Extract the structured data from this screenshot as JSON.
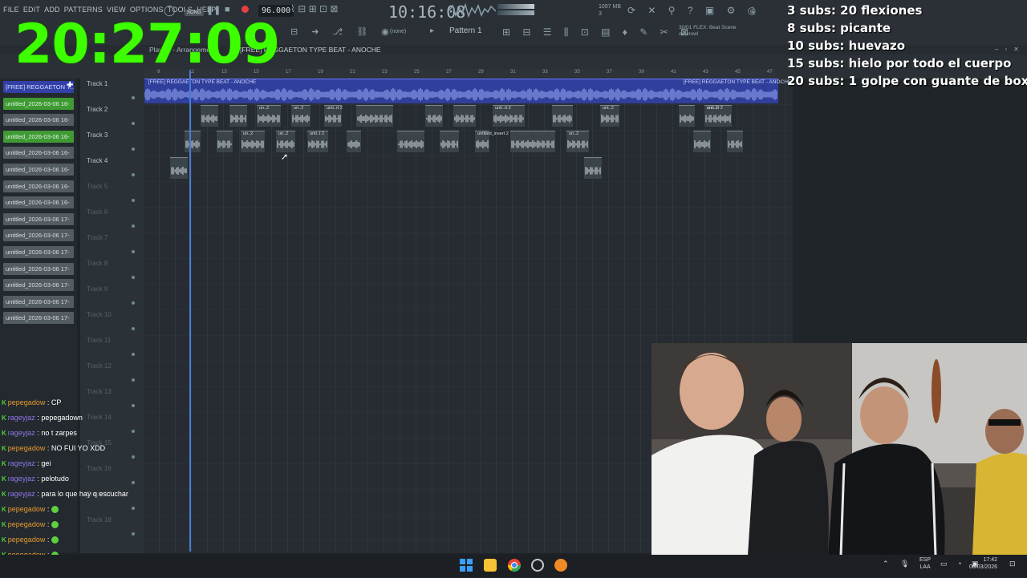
{
  "menu": [
    "FILE",
    "EDIT",
    "ADD",
    "PATTERNS",
    "VIEW",
    "OPTIONS",
    "TOOLS",
    "HELP"
  ],
  "transport": {
    "song_label": "SONG",
    "tempo": "96.000",
    "time": "10:16:08",
    "pattern": "Pattern 1",
    "snap": "(none)",
    "cpu_text": "1097 MB",
    "cpu_sub": "3"
  },
  "news": {
    "line1": "30/01  FLEX: Beat Scene",
    "line2": "out now!"
  },
  "overlay_clock": "20:27:09",
  "subs": [
    "3 subs: 20 flexiones",
    "8 subs: picante",
    "10 subs: huevazo",
    "15 subs: hielo por todo el cuerpo",
    "20 subs: 1 golpe con guante de box"
  ],
  "playlist": {
    "title_prefix": "Playlist - Arrangement",
    "title_clip": "[FREE] REGGAETON TYPE BEAT - ANOCHE",
    "beat_clip_label": "[FREE] REGGAETON TYPE BEAT - ANOCHE",
    "ruler": [
      "9",
      "11",
      "13",
      "15",
      "17",
      "19",
      "21",
      "23",
      "25",
      "27",
      "29",
      "31",
      "33",
      "35",
      "37",
      "39",
      "41",
      "43",
      "45",
      "47"
    ],
    "tracks": [
      "Track 1",
      "Track 2",
      "Track 3",
      "Track 4",
      "Track 5",
      "Track 6",
      "Track 7",
      "Track 8",
      "Track 9",
      "Track 10",
      "Track 11",
      "Track 12",
      "Track 13",
      "Track 14",
      "Track 15",
      "Track 16",
      "Track 17",
      "Track 18"
    ],
    "clip_labels_t2": [
      "un..2",
      "un..2",
      "unti..rt 2",
      "unti..rt 2",
      "unt..2",
      "unti..rt 2",
      "unt..2"
    ],
    "clip_labels_t3": [
      "un..2",
      "un..2",
      "unti..t 2",
      "untitled_insert 2",
      "un..2"
    ]
  },
  "picker": [
    {
      "label": "[FREE] REGGAETON T...",
      "style": "blue"
    },
    {
      "label": "untitled_2026-03-06 16-",
      "style": "green"
    },
    {
      "label": "untitled_2026-03-06 16-",
      "style": "grey"
    },
    {
      "label": "untitled_2026-03-06 16-",
      "style": "green"
    },
    {
      "label": "untitled_2026-03-06 16-",
      "style": "grey"
    },
    {
      "label": "untitled_2026-03-06 16-",
      "style": "grey"
    },
    {
      "label": "untitled_2026-03-06 16-",
      "style": "grey"
    },
    {
      "label": "untitled_2026-03-06 16-",
      "style": "grey"
    },
    {
      "label": "untitled_2026-03-06 17-",
      "style": "grey"
    },
    {
      "label": "untitled_2026-03-06 17-",
      "style": "grey"
    },
    {
      "label": "untitled_2026-03-06 17-",
      "style": "grey"
    },
    {
      "label": "untitled_2026-03-06 17-",
      "style": "grey"
    },
    {
      "label": "untitled_2026-03-06 17-",
      "style": "grey"
    },
    {
      "label": "untitled_2026-03-06 17-",
      "style": "grey"
    },
    {
      "label": "untitled_2026-03-06 17-",
      "style": "grey"
    }
  ],
  "chat": [
    {
      "user": "pepegadow",
      "sep": " : ",
      "msg": "CP",
      "cls": "u-pepe"
    },
    {
      "user": "rageyjaz",
      "sep": " : ",
      "msg": "pepegadown",
      "cls": "u-rage"
    },
    {
      "user": "rageyjaz",
      "sep": " : ",
      "msg": "no t zarpes",
      "cls": "u-rage"
    },
    {
      "user": "pepegadow",
      "sep": " : ",
      "msg": "NO FUI YO XDD",
      "cls": "u-pepe"
    },
    {
      "user": "rageyjaz",
      "sep": " : ",
      "msg": "gei",
      "cls": "u-rage"
    },
    {
      "user": "rageyjaz",
      "sep": " : ",
      "msg": "pelotudo",
      "cls": "u-rage"
    },
    {
      "user": "rageyjaz",
      "sep": " : ",
      "msg": "para lo que hay q escuchar",
      "cls": "u-rage"
    },
    {
      "user": "pepegadow",
      "sep": " : ",
      "msg": "",
      "cls": "u-pepe"
    },
    {
      "user": "pepegadow",
      "sep": " : ",
      "msg": "",
      "cls": "u-pepe"
    },
    {
      "user": "pepegadow",
      "sep": " : ",
      "msg": "",
      "cls": "u-pepe"
    },
    {
      "user": "pepegadow",
      "sep": " : ",
      "msg": "",
      "cls": "u-pepe"
    },
    {
      "user": "pepegadow",
      "sep": " : ",
      "msg": "",
      "cls": "u-pepe"
    }
  ],
  "taskbar": {
    "lang_top": "ESP",
    "lang_bottom": "LAA",
    "time": "17:42",
    "date": "06/03/2026"
  },
  "colors": {
    "overlay_green": "#3dff00",
    "accent_blue": "#3240a8",
    "clip_green": "#3f9a34"
  }
}
